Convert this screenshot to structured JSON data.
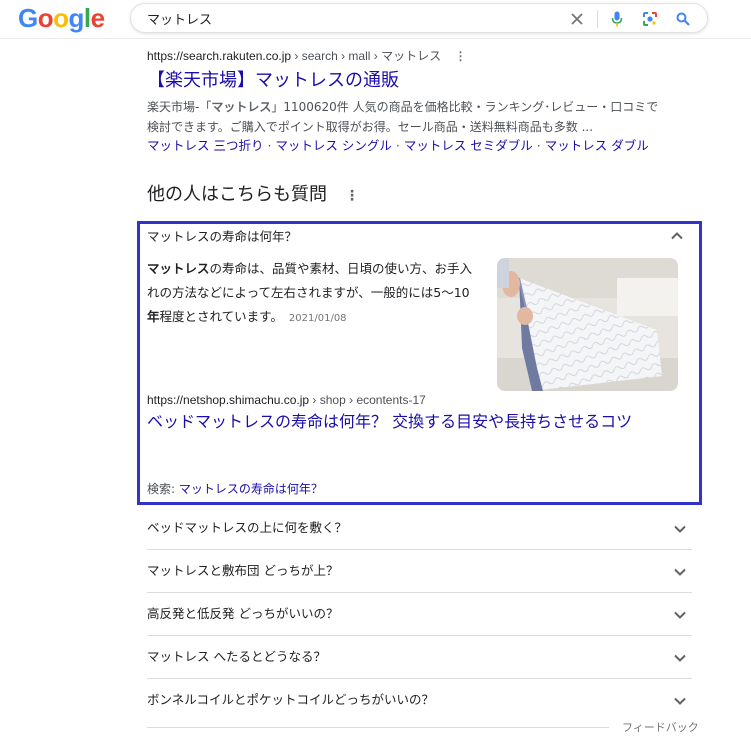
{
  "search": {
    "query": "マットレス"
  },
  "logo": [
    "G",
    "o",
    "o",
    "g",
    "l",
    "e"
  ],
  "colors": {
    "accent_border": "#3333cc",
    "link": "#1a0dab"
  },
  "result": {
    "host": "https://search.rakuten.co.jp",
    "path": " › search › mall › マットレス",
    "title": "【楽天市場】マットレスの通販",
    "snippet_pre": "楽天市場-「",
    "snippet_bold": "マットレス",
    "snippet_post": "」1100620件 人気の商品を価格比較・ランキング･レビュー・口コミで検討できます。ご購入でポイント取得がお得。セール商品・送料無料商品も多数 ...",
    "sitelinks": [
      "マットレス 三つ折り",
      "マットレス シングル",
      "マットレス セミダブル",
      "マットレス ダブル"
    ],
    "sitelink_sep": " · "
  },
  "paa": {
    "title": "他の人はこちらも質問",
    "expanded": {
      "question": "マットレスの寿命は何年？",
      "answer_bold": "マットレス",
      "answer_mid": "の寿命は、品質や素材、日頃の使い方、お手入れの方法などによって左右されますが、一般的には5〜10",
      "answer_bold2": "年",
      "answer_end": "程度とされています。",
      "date": "2021/01/08",
      "source_host": "https://netshop.shimachu.co.jp",
      "source_path": " › shop › econtents-17",
      "source_title": "ベッドマットレスの寿命は何年？ 交換する目安や長持ちさせるコツ",
      "search_label": "検索: ",
      "search_query": "マットレスの寿命は何年？"
    },
    "questions": [
      "ベッドマットレスの上に何を敷く？",
      "マットレスと敷布団 どっちが上？",
      "高反発と低反発 どっちがいいの？",
      "マットレス へたるとどうなる？",
      "ボンネルコイルとポケットコイルどっちがいいの？"
    ]
  },
  "feedback": "フィードバック"
}
